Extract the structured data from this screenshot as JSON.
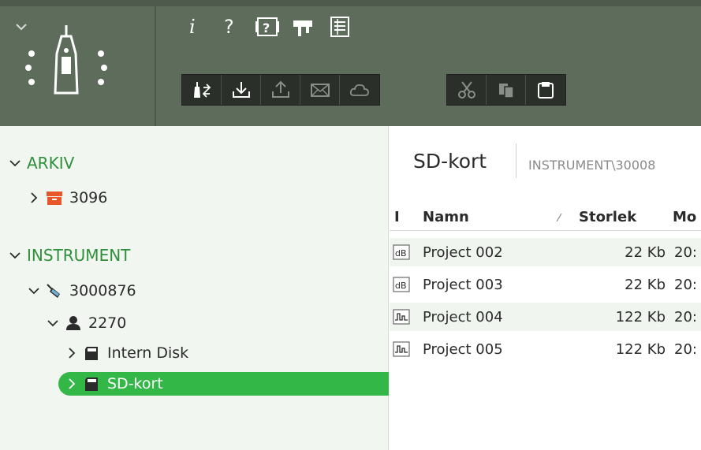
{
  "toolbar": {
    "top_icons": [
      {
        "name": "info-icon",
        "glyph": "i"
      },
      {
        "name": "help-icon",
        "glyph": "?"
      },
      {
        "name": "help-box-icon",
        "glyph": "?"
      },
      {
        "name": "projector-icon",
        "glyph": ""
      },
      {
        "name": "report-icon",
        "glyph": ""
      }
    ],
    "group1": [
      "transfer-icon",
      "download-icon",
      "upload-icon",
      "mail-icon",
      "cloud-icon"
    ],
    "group2": [
      "cut-icon",
      "copy-icon",
      "paste-icon"
    ]
  },
  "sidebar": {
    "arkiv": {
      "label": "ARKIV",
      "children": [
        {
          "label": "3096"
        }
      ]
    },
    "instrument": {
      "label": "INSTRUMENT",
      "device": {
        "label": "3000876"
      },
      "user": {
        "label": "2270"
      },
      "intern": {
        "label": "Intern Disk"
      },
      "sd": {
        "label": "SD-kort"
      }
    }
  },
  "main": {
    "title": "SD-kort",
    "path": "INSTRUMENT\\30008",
    "columns": {
      "i": "I",
      "name": "Namn",
      "size": "Storlek",
      "modified": "Mo"
    },
    "rows": [
      {
        "type": "dB",
        "name": "Project 002",
        "size": "22 Kb",
        "modified": "20:"
      },
      {
        "type": "wave",
        "name": "Project 003",
        "size": "22 Kb",
        "modified": "20:"
      },
      {
        "type": "wave",
        "name": "Project 004",
        "size": "122 Kb",
        "modified": "20:"
      },
      {
        "type": "wave",
        "name": "Project 005",
        "size": "122 Kb",
        "modified": "20:"
      }
    ]
  },
  "colors": {
    "accent": "#33b848",
    "tree_root": "#2f8f3a",
    "toolbar_bg": "#5e6c5c",
    "sidebar_bg": "#f1f6f0"
  }
}
